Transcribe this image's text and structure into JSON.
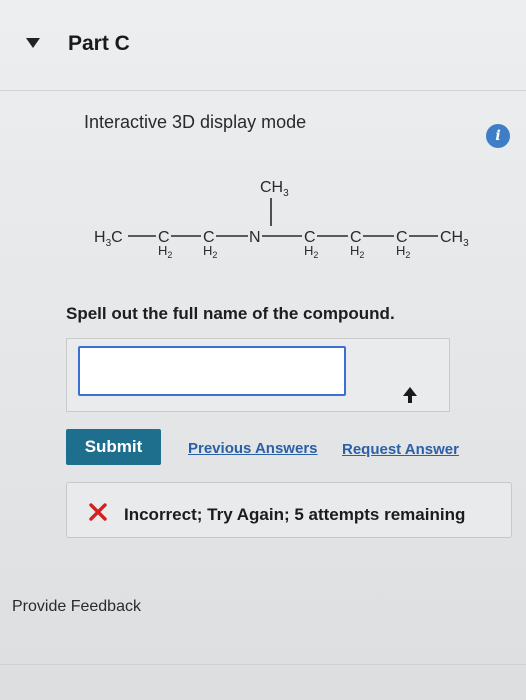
{
  "part": {
    "title": "Part C"
  },
  "mode": {
    "label": "Interactive 3D display mode",
    "info_icon": "info-icon"
  },
  "molecule": {
    "groups": {
      "h3c": "H3C",
      "c1": "C",
      "c1h": "H2",
      "c2": "C",
      "c2h": "H2",
      "n": "N",
      "nch3": "CH3",
      "c3": "C",
      "c3h": "H2",
      "c4": "C",
      "c4h": "H2",
      "c5": "C",
      "c5h": "H2",
      "tail": "CH3"
    }
  },
  "question": {
    "text": "Spell out the full name of the compound."
  },
  "answer": {
    "value": "",
    "placeholder": ""
  },
  "actions": {
    "submit_label": "Submit",
    "previous_answers_label": "Previous Answers",
    "request_answer_label": "Request Answer"
  },
  "feedback": {
    "status": "incorrect",
    "message": "Incorrect; Try Again; 5 attempts remaining",
    "error_color": "#d22020"
  },
  "footer": {
    "provide_feedback_label": "Provide Feedback"
  },
  "colors": {
    "accent": "#1e6f8d",
    "link": "#2b5fa6",
    "input_border": "#3b6fd0",
    "info": "#3d7ec7"
  }
}
